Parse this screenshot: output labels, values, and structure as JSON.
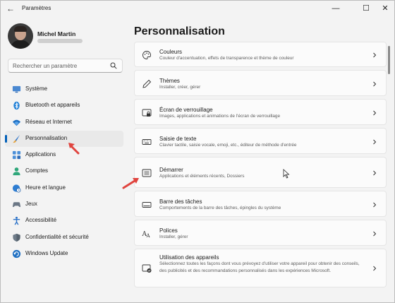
{
  "window": {
    "title": "Paramètres"
  },
  "user": {
    "name": "Michel Martin"
  },
  "search": {
    "placeholder": "Rechercher un paramètre"
  },
  "nav": [
    {
      "label": "Système",
      "icon": "monitor-icon"
    },
    {
      "label": "Bluetooth et appareils",
      "icon": "bluetooth-icon"
    },
    {
      "label": "Réseau et Internet",
      "icon": "wifi-icon"
    },
    {
      "label": "Personnalisation",
      "icon": "brush-icon",
      "active": true
    },
    {
      "label": "Applications",
      "icon": "apps-icon"
    },
    {
      "label": "Comptes",
      "icon": "person-icon"
    },
    {
      "label": "Heure et langue",
      "icon": "globe-clock-icon"
    },
    {
      "label": "Jeux",
      "icon": "gamepad-icon"
    },
    {
      "label": "Accessibilité",
      "icon": "accessibility-icon"
    },
    {
      "label": "Confidentialité et sécurité",
      "icon": "shield-icon"
    },
    {
      "label": "Windows Update",
      "icon": "update-icon"
    }
  ],
  "page": {
    "title": "Personnalisation"
  },
  "cards": [
    {
      "title": "Couleurs",
      "desc": "Couleur d'accentuation, effets de transparence et thème de couleur",
      "icon": "palette-icon"
    },
    {
      "title": "Thèmes",
      "desc": "Installer, créer, gérer",
      "icon": "pen-icon"
    },
    {
      "title": "Écran de verrouillage",
      "desc": "Images, applications et animations de l'écran de verrouillage",
      "icon": "lock-screen-icon"
    },
    {
      "title": "Saisie de texte",
      "desc": "Clavier tactile, saisie vocale, emoji, etc., éditeur de méthode d'entrée",
      "icon": "keyboard-icon"
    },
    {
      "title": "Démarrer",
      "desc": "Applications et éléments récents, Dossiers",
      "icon": "start-menu-icon"
    },
    {
      "title": "Barre des tâches",
      "desc": "Comportements de la barre des tâches, épingles du système",
      "icon": "taskbar-icon"
    },
    {
      "title": "Polices",
      "desc": "Installer, gérer",
      "icon": "fonts-icon"
    },
    {
      "title": "Utilisation des appareils",
      "desc": "Sélectionnez toutes les façons dont vous prévoyez d'utiliser votre appareil pour obtenir des conseils, des publicités et des recommandations personnalisés dans les expériences Microsoft.",
      "icon": "device-usage-icon"
    }
  ],
  "colors": {
    "accent": "#005fb8",
    "annotation_arrow": "#e0443e"
  }
}
